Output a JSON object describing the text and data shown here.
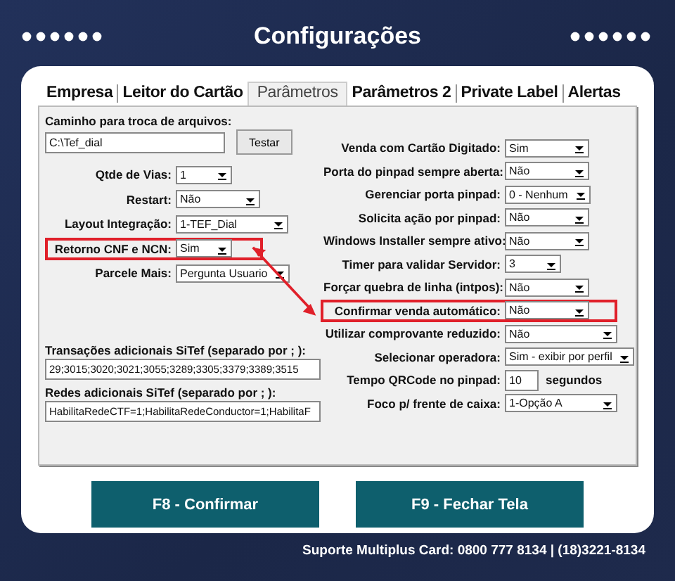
{
  "window": {
    "title": "Configurações"
  },
  "tabs": [
    {
      "label": "Empresa",
      "selected": false
    },
    {
      "label": "Leitor do Cartão",
      "selected": false
    },
    {
      "label": "Parâmetros",
      "selected": true
    },
    {
      "label": "Parâmetros 2",
      "selected": false
    },
    {
      "label": "Private Label",
      "selected": false
    },
    {
      "label": "Alertas",
      "selected": false
    }
  ],
  "path": {
    "label": "Caminho para troca de arquivos:",
    "value": "C:\\Tef_dial",
    "button": "Testar"
  },
  "left_fields": [
    {
      "label": "Qtde de Vias:",
      "value": "1",
      "kind": "short",
      "highlighted": false
    },
    {
      "label": "Restart:",
      "value": "Não",
      "kind": "medium",
      "highlighted": false
    },
    {
      "label": "Layout Integração:",
      "value": "1-TEF_Dial",
      "kind": "wide",
      "highlighted": false
    },
    {
      "label": "Retorno CNF e NCN:",
      "value": "Sim",
      "kind": "short",
      "highlighted": true
    },
    {
      "label": "Parcele Mais:",
      "value": "Pergunta Usuario",
      "kind": "medium",
      "highlighted": false
    }
  ],
  "lists": [
    {
      "label": "Transações adicionais SiTef (separado por ; ):",
      "value": "29;3015;3020;3021;3055;3289;3305;3379;3389;3515"
    },
    {
      "label": "Redes adicionais SiTef (separado por ; ):",
      "value": "HabilitaRedeCTF=1;HabilitaRedeConductor=1;HabilitaF"
    }
  ],
  "right_fields": [
    {
      "label": "Venda com Cartão Digitado:",
      "value": "Sim",
      "kind": "medium",
      "highlighted": false
    },
    {
      "label": "Porta do pinpad sempre aberta:",
      "value": "Não",
      "kind": "medium",
      "highlighted": false
    },
    {
      "label": "Gerenciar porta pinpad:",
      "value": "0 - Nenhum",
      "kind": "medium",
      "highlighted": false
    },
    {
      "label": "Solicita ação por pinpad:",
      "value": "Não",
      "kind": "medium",
      "highlighted": false
    },
    {
      "label": "Windows Installer sempre ativo:",
      "value": "Não",
      "kind": "medium",
      "highlighted": false
    },
    {
      "label": "Timer para validar Servidor:",
      "value": "3",
      "kind": "short",
      "highlighted": false
    },
    {
      "label": "Forçar quebra de linha (intpos):",
      "value": "Não",
      "kind": "medium",
      "highlighted": false
    },
    {
      "label": "Confirmar venda automático:",
      "value": "Não",
      "kind": "medium",
      "highlighted": true
    },
    {
      "label": "Utilizar comprovante reduzido:",
      "value": "Não",
      "kind": "wide",
      "highlighted": false
    },
    {
      "label": "Selecionar operadora:",
      "value": "Sim - exibir por perfil",
      "kind": "wide",
      "highlighted": false
    },
    {
      "label": "Tempo QRCode no pinpad:",
      "value": "10",
      "kind": "input",
      "unit": "segundos",
      "highlighted": false
    },
    {
      "label": "Foco p/ frente de caixa:",
      "value": "1-Opção A",
      "kind": "wide",
      "highlighted": false
    }
  ],
  "buttons": [
    "F8 - Confirmar",
    "F9 - Fechar Tela"
  ],
  "status_bar": "Suporte Multiplus Card: 0800 777 8134 | (18)3221-8134"
}
